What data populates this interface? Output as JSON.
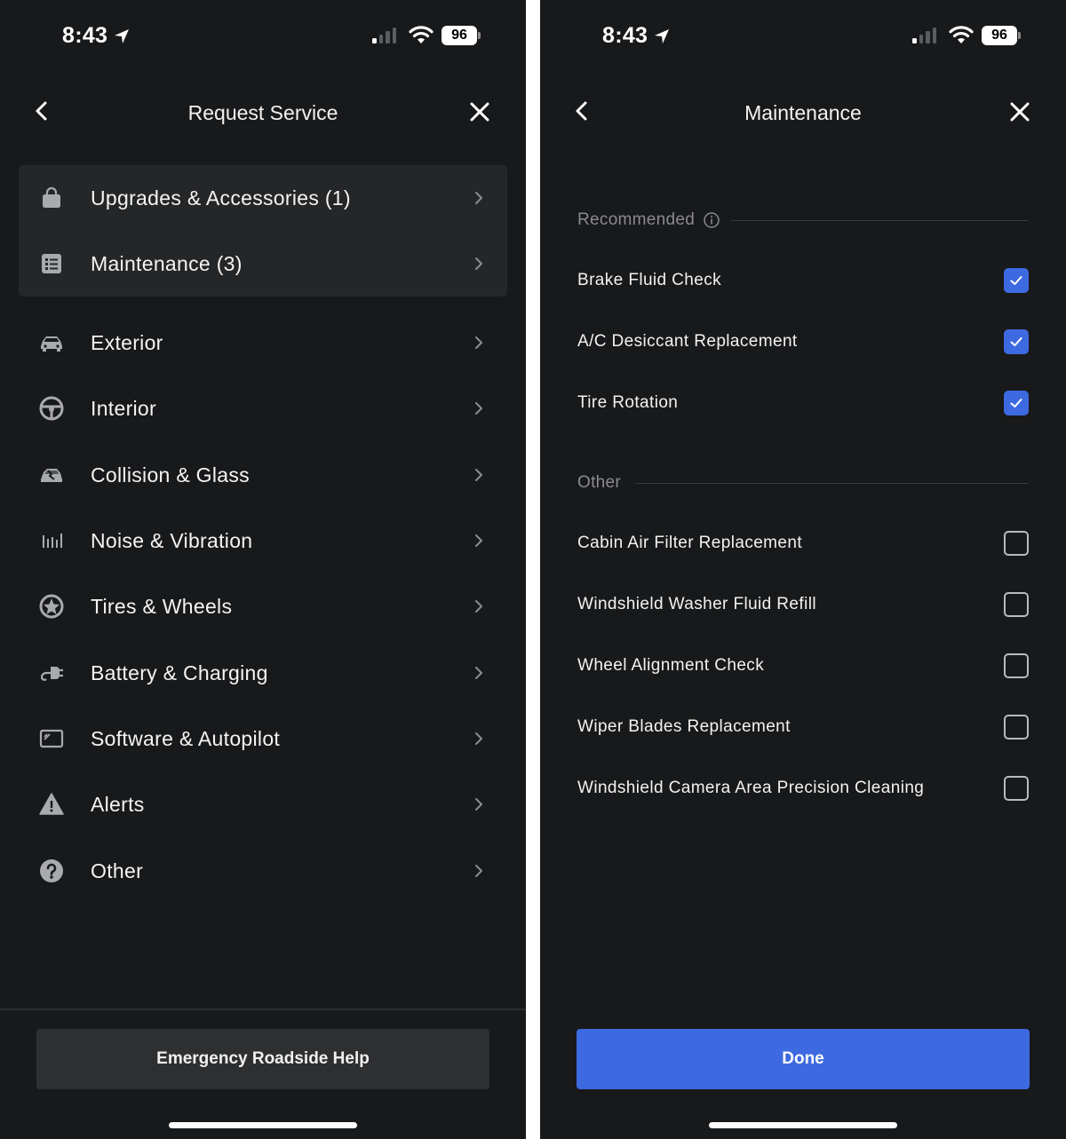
{
  "status_bar": {
    "time": "8:43",
    "battery": "96"
  },
  "left": {
    "title": "Request Service",
    "featured": [
      {
        "label": "Upgrades & Accessories (1)",
        "icon": "shopping-bag-icon"
      },
      {
        "label": "Maintenance (3)",
        "icon": "checklist-icon"
      }
    ],
    "categories": [
      {
        "label": "Exterior",
        "icon": "car-icon"
      },
      {
        "label": "Interior",
        "icon": "steering-wheel-icon"
      },
      {
        "label": "Collision & Glass",
        "icon": "collision-icon"
      },
      {
        "label": "Noise & Vibration",
        "icon": "sound-bars-icon"
      },
      {
        "label": "Tires & Wheels",
        "icon": "wheel-icon"
      },
      {
        "label": "Battery & Charging",
        "icon": "charging-plug-icon"
      },
      {
        "label": "Software & Autopilot",
        "icon": "screen-icon"
      },
      {
        "label": "Alerts",
        "icon": "warning-icon"
      },
      {
        "label": "Other",
        "icon": "question-icon"
      }
    ],
    "emergency_label": "Emergency Roadside Help"
  },
  "right": {
    "title": "Maintenance",
    "recommended_label": "Recommended",
    "recommended": [
      {
        "label": "Brake Fluid Check",
        "checked": true
      },
      {
        "label": "A/C Desiccant Replacement",
        "checked": true
      },
      {
        "label": "Tire Rotation",
        "checked": true
      }
    ],
    "other_label": "Other",
    "other": [
      {
        "label": "Cabin Air Filter Replacement",
        "checked": false
      },
      {
        "label": "Windshield Washer Fluid Refill",
        "checked": false
      },
      {
        "label": "Wheel Alignment Check",
        "checked": false
      },
      {
        "label": "Wiper Blades Replacement",
        "checked": false
      },
      {
        "label": "Windshield Camera Area Precision Cleaning",
        "checked": false
      }
    ],
    "done_label": "Done"
  },
  "colors": {
    "accent": "#3e6ae1",
    "background": "#18191b",
    "card": "#252628"
  }
}
